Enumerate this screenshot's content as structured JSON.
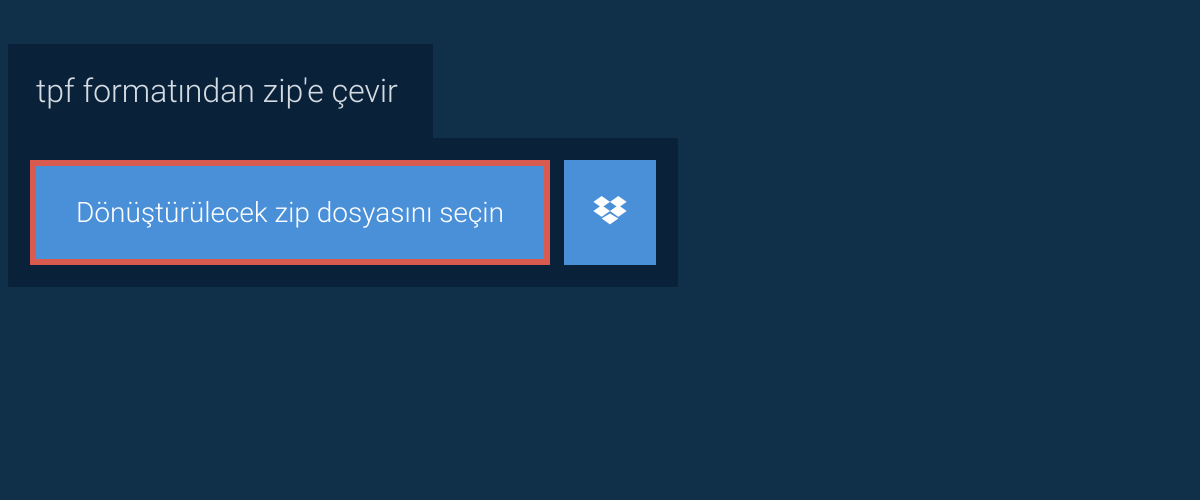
{
  "header": {
    "title": "tpf formatından zip'e çevir"
  },
  "upload": {
    "select_file_label": "Dönüştürülecek zip dosyasını seçin"
  },
  "colors": {
    "page_bg": "#10304a",
    "panel_bg": "#0a213a",
    "button_bg": "#4a90d9",
    "button_border": "#d95a4f",
    "text_light": "#d4dce2"
  }
}
